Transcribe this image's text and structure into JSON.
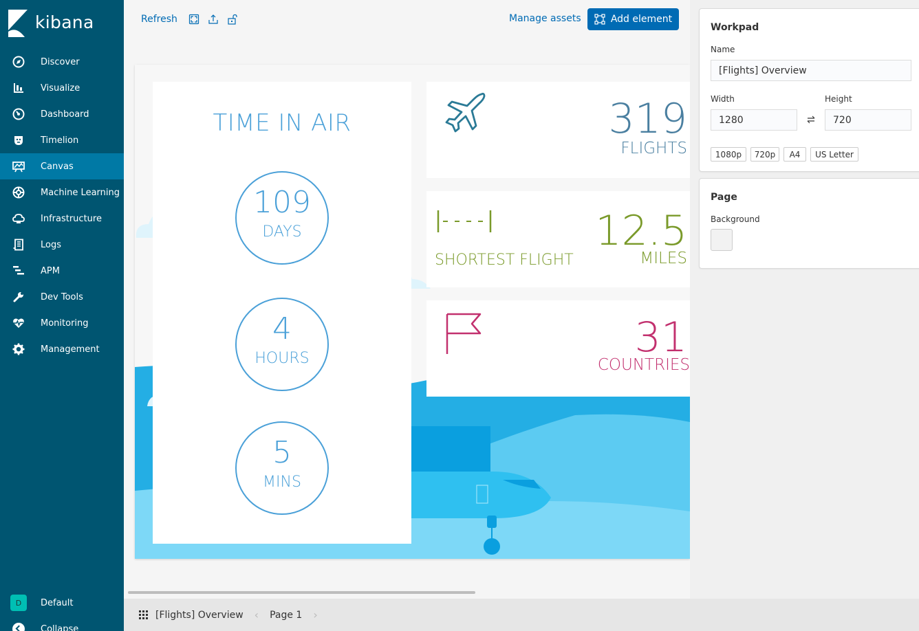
{
  "app": {
    "name": "kibana"
  },
  "nav": {
    "items": [
      {
        "label": "Discover",
        "icon": "compass-icon"
      },
      {
        "label": "Visualize",
        "icon": "bar-chart-icon"
      },
      {
        "label": "Dashboard",
        "icon": "dashboard-icon"
      },
      {
        "label": "Timelion",
        "icon": "timelion-icon"
      },
      {
        "label": "Canvas",
        "icon": "canvas-icon",
        "active": true
      },
      {
        "label": "Machine Learning",
        "icon": "machine-learning-icon"
      },
      {
        "label": "Infrastructure",
        "icon": "infrastructure-icon"
      },
      {
        "label": "Logs",
        "icon": "logs-icon"
      },
      {
        "label": "APM",
        "icon": "apm-icon"
      },
      {
        "label": "Dev Tools",
        "icon": "wrench-icon"
      },
      {
        "label": "Monitoring",
        "icon": "heartbeat-icon"
      },
      {
        "label": "Management",
        "icon": "gear-icon"
      }
    ],
    "space": {
      "initial": "D",
      "label": "Default"
    },
    "collapse_label": "Collapse"
  },
  "toolbar": {
    "refresh_label": "Refresh",
    "manage_assets_label": "Manage assets",
    "add_element_label": "Add element"
  },
  "workpad_content": {
    "time_title": "TIME IN AIR",
    "days": {
      "value": "109",
      "unit": "DAYS"
    },
    "hours": {
      "value": "4",
      "unit": "HOURS"
    },
    "mins": {
      "value": "5",
      "unit": "MINS"
    },
    "flights": {
      "value": "319",
      "label": "FLIGHTS",
      "color": "#4a7fa0"
    },
    "shortest": {
      "value": "12.5",
      "unit": "MILES",
      "label": "SHORTEST FLIGHT",
      "color": "#7a9a2a"
    },
    "countries": {
      "value": "31",
      "label": "COUNTRIES",
      "color": "#c2306e"
    }
  },
  "footer": {
    "workpad_name": "[Flights] Overview",
    "page_label": "Page 1"
  },
  "sidebar_panel": {
    "workpad_title": "Workpad",
    "name_label": "Name",
    "name_value": "[Flights] Overview",
    "width_label": "Width",
    "width_value": "1280",
    "height_label": "Height",
    "height_value": "720",
    "presets": [
      "1080p",
      "720p",
      "A4",
      "US Letter"
    ],
    "page_title": "Page",
    "background_label": "Background"
  },
  "colors": {
    "sidebar": "#005571",
    "active_nav": "#0079a5",
    "accent": "#006bb4",
    "sky_blue": "#4aa0d8"
  }
}
